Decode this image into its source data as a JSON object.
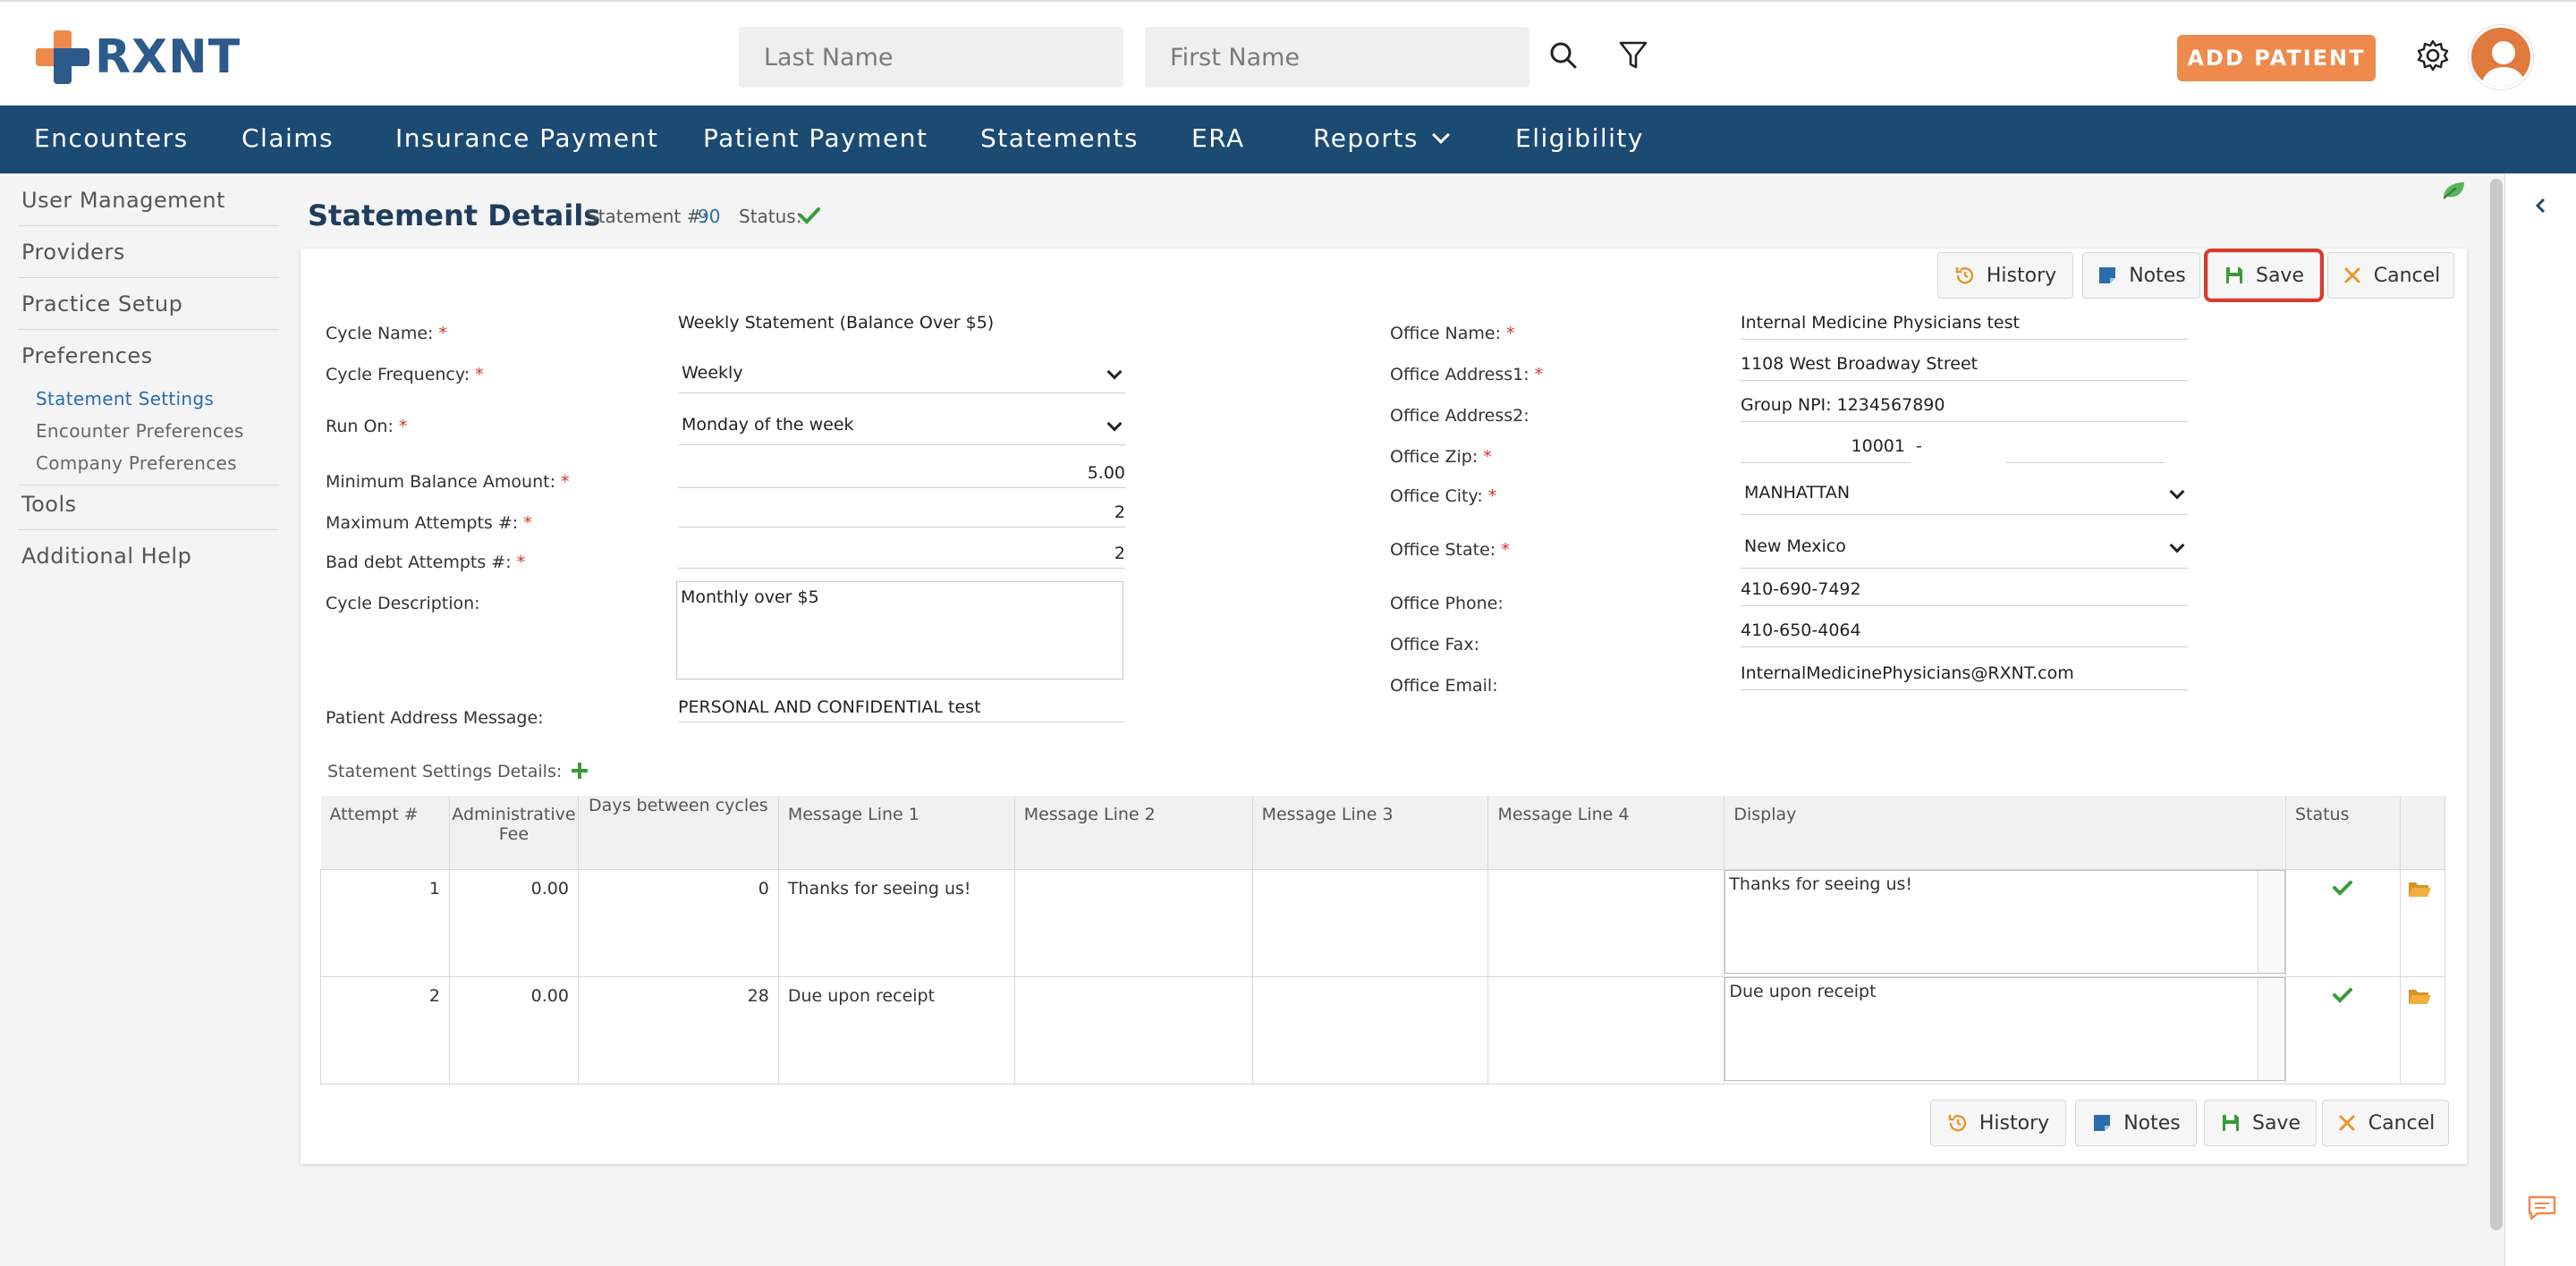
{
  "header": {
    "logo_text": "RXNT",
    "last_name_placeholder": "Last Name",
    "first_name_placeholder": "First Name",
    "add_patient_label": "ADD PATIENT"
  },
  "nav": {
    "items": [
      "Encounters",
      "Claims",
      "Insurance Payment",
      "Patient Payment",
      "Statements",
      "ERA",
      "Reports",
      "Eligibility"
    ]
  },
  "sidebar": {
    "items": [
      "User Management",
      "Providers",
      "Practice Setup",
      "Preferences"
    ],
    "sub_items": [
      "Statement Settings",
      "Encounter Preferences",
      "Company Preferences"
    ],
    "items_bottom": [
      "Tools",
      "Additional Help"
    ]
  },
  "page": {
    "title": "Statement Details",
    "statement_label": "Statement #:",
    "statement_number": "90",
    "status_label": "Status:"
  },
  "toolbar": {
    "history_label": "History",
    "notes_label": "Notes",
    "save_label": "Save",
    "cancel_label": "Cancel"
  },
  "form_left": {
    "cycle_name_label": "Cycle Name:",
    "cycle_name_value": "Weekly Statement (Balance Over $5)",
    "cycle_frequency_label": "Cycle Frequency:",
    "cycle_frequency_value": "Weekly",
    "run_on_label": "Run On:",
    "run_on_value": "Monday of the week",
    "min_balance_label": "Minimum Balance Amount:",
    "min_balance_value": "5.00",
    "max_attempts_label": "Maximum Attempts #:",
    "max_attempts_value": "2",
    "bad_debt_label": "Bad debt Attempts #:",
    "bad_debt_value": "2",
    "cycle_desc_label": "Cycle Description:",
    "cycle_desc_value": "Monthly over $5",
    "patient_addr_msg_label": "Patient Address Message:",
    "patient_addr_msg_value": "PERSONAL AND CONFIDENTIAL test"
  },
  "form_right": {
    "office_name_label": "Office Name:",
    "office_name_value": "Internal Medicine Physicians test",
    "office_addr1_label": "Office Address1:",
    "office_addr1_value": "1108 West Broadway Street",
    "office_addr2_label": "Office Address2:",
    "office_addr2_value": "Group NPI: 1234567890",
    "office_zip_label": "Office Zip:",
    "office_zip_value": "10001",
    "zip_separator": "-",
    "office_city_label": "Office City:",
    "office_city_value": "MANHATTAN",
    "office_state_label": "Office State:",
    "office_state_value": "New Mexico",
    "office_phone_label": "Office Phone:",
    "office_phone_value": "410-690-7492",
    "office_fax_label": "Office Fax:",
    "office_fax_value": "410-650-4064",
    "office_email_label": "Office Email:",
    "office_email_value": "InternalMedicinePhysicians@RXNT.com"
  },
  "details": {
    "section_label": "Statement Settings Details:",
    "columns": [
      "Attempt #",
      "Administrative Fee",
      "Days between cycles",
      "Message Line 1",
      "Message Line 2",
      "Message Line 3",
      "Message Line 4",
      "Display",
      "Status"
    ],
    "rows": [
      {
        "attempt": "1",
        "fee": "0.00",
        "days": "0",
        "line1": "Thanks for seeing us!",
        "line2": "",
        "line3": "",
        "line4": "",
        "display": "Thanks for seeing us!"
      },
      {
        "attempt": "2",
        "fee": "0.00",
        "days": "28",
        "line1": "Due upon receipt",
        "line2": "",
        "line3": "",
        "line4": "",
        "display": "Due upon receipt"
      }
    ]
  },
  "colors": {
    "nav_bg": "#1b4a73",
    "accent_orange": "#ef8a4d",
    "status_green": "#3a9a3a",
    "highlight_red": "#d93b2b"
  }
}
